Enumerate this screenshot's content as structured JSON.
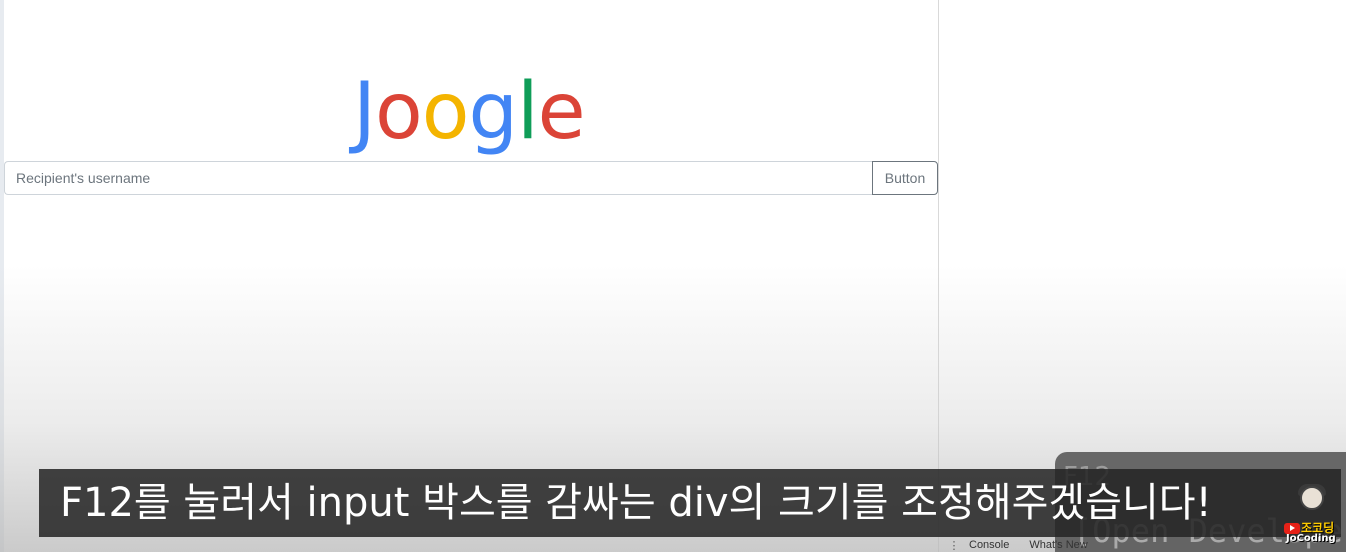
{
  "page": {
    "logo": {
      "letters": [
        "J",
        "o",
        "o",
        "g",
        "l",
        "e"
      ],
      "colors": [
        "#4285F4",
        "#DB4437",
        "#F4B400",
        "#4285F4",
        "#0F9D58",
        "#DB4437"
      ]
    },
    "search": {
      "placeholder": "Recipient's username",
      "value": "",
      "button_label": "Button"
    }
  },
  "devtools": {
    "overlay_key": "F12",
    "overlay_text": "[Open Developer",
    "drawer_tabs": [
      "Console",
      "What's New"
    ]
  },
  "video": {
    "subtitle": "F12를 눌러서 input 박스를 감싸는 div의 크기를 조정해주겠습니다!",
    "channel_name_ko": "조코딩",
    "channel_name_en": "JoCoding",
    "accent_red": "#e62117"
  }
}
